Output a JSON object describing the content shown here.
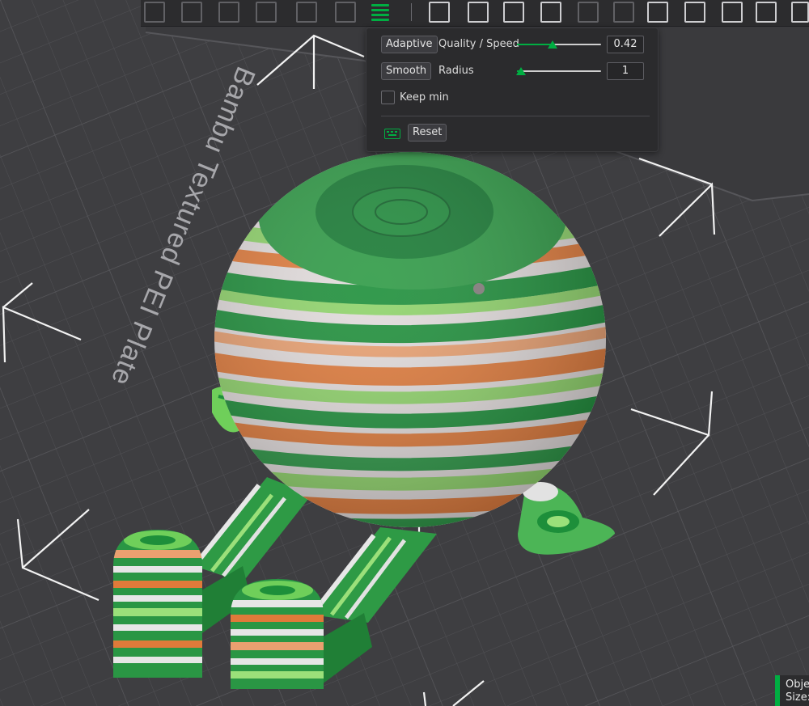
{
  "plate": {
    "label": "Bambu Textured PEI Plate"
  },
  "panel": {
    "adaptive_label": "Adaptive",
    "quality_speed_label": "Quality / Speed",
    "quality_speed_value": "0.42",
    "quality_speed_fraction": 0.42,
    "smooth_label": "Smooth",
    "radius_label": "Radius",
    "radius_value": "1",
    "radius_fraction": 0.05,
    "keep_min_label": "Keep min",
    "keep_min_checked": false,
    "reset_label": "Reset"
  },
  "status": {
    "objects_label": "Obje",
    "size_label": "Size:"
  },
  "colors": {
    "accent": "#00ae42",
    "panel_bg": "#2b2b2d",
    "plate_bg": "#3d3d40",
    "stripe_green_dark": "#1d8f3a",
    "stripe_green_light": "#8fd46a",
    "stripe_orange": "#e07a3a",
    "stripe_white": "#e4dede"
  },
  "toolbar": {
    "icons": [
      "add-object-icon",
      "add-plate-icon",
      "auto-orient-icon",
      "arrange-icon",
      "split-objects-icon",
      "split-parts-icon",
      "variable-layer-height-icon",
      "move-icon",
      "rotate-icon",
      "scale-icon",
      "lay-on-face-icon",
      "cut-icon",
      "paint-support-icon",
      "mesh-boolean-icon",
      "measure-icon",
      "text-emboss-icon",
      "color-painting-icon",
      "assembly-icon"
    ]
  }
}
